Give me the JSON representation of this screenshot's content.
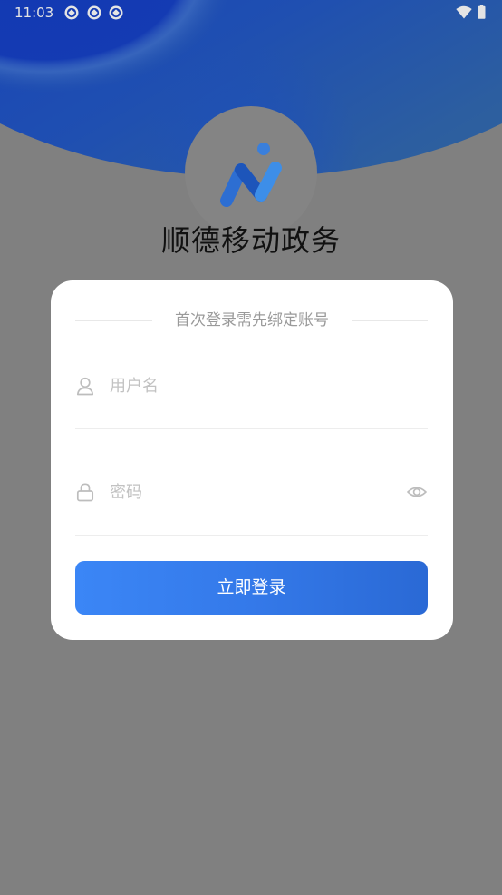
{
  "status_bar": {
    "time": "11:03",
    "left_icons": [
      "app-notification-icon",
      "app-notification-icon",
      "app-notification-icon"
    ],
    "right_icons": [
      "wifi-icon",
      "battery-icon"
    ]
  },
  "header": {
    "logo": "app-logo-icon",
    "app_title": "顺德移动政务"
  },
  "login_card": {
    "subtitle": "首次登录需先绑定账号",
    "username": {
      "icon": "user-icon",
      "placeholder": "用户名",
      "value": ""
    },
    "password": {
      "icon": "lock-icon",
      "placeholder": "密码",
      "value": "",
      "toggle_icon": "eye-icon"
    },
    "submit_button": {
      "label": "立即登录"
    }
  },
  "colors": {
    "page_background": "#808080",
    "header_blue": "#1d4cb2",
    "accent_blue": "#3a83f3",
    "title_text": "#111111",
    "muted_text": "#9a9a9a",
    "placeholder_text": "#c2c2c2"
  }
}
